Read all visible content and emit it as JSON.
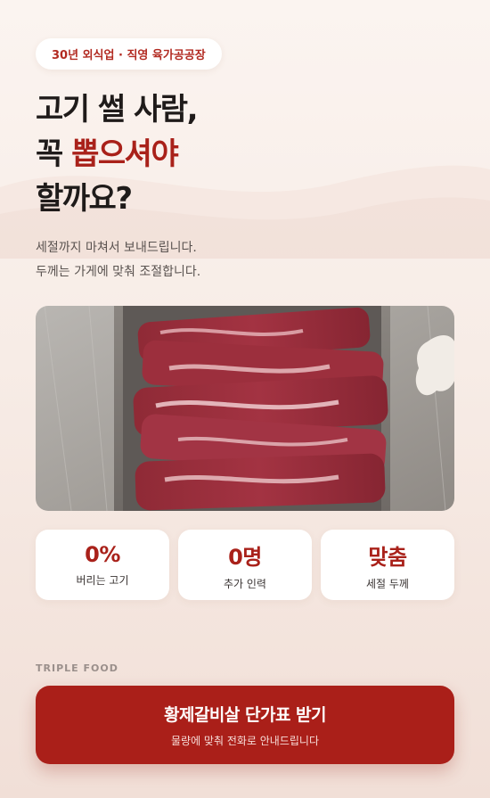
{
  "badge": {
    "text": "30년 외식업 · 직영 육가공공장"
  },
  "headline": {
    "line1": "고기 썰 사람,",
    "line2_prefix": "꼭 ",
    "line2_accent": "뽑으셔야",
    "line3": "할까요?"
  },
  "description": {
    "line1": "세절까지 마쳐서 보내드립니다.",
    "line2": "두께는 가게에 맞춰 조절합니다."
  },
  "stats": [
    {
      "value": "0%",
      "label": "버리는 고기"
    },
    {
      "value": "0명",
      "label": "추가 인력"
    },
    {
      "value": "맞춤",
      "label": "세절 두께"
    }
  ],
  "brand": "TRIPLE FOOD",
  "cta": {
    "title": "황제갈비살 단가표 받기",
    "subtitle": "물량에 맞춰 전화로 안내드립니다"
  },
  "colors": {
    "accent": "#a9211a",
    "cta_bg": "#aa1f19",
    "background": "#f7ece6"
  }
}
